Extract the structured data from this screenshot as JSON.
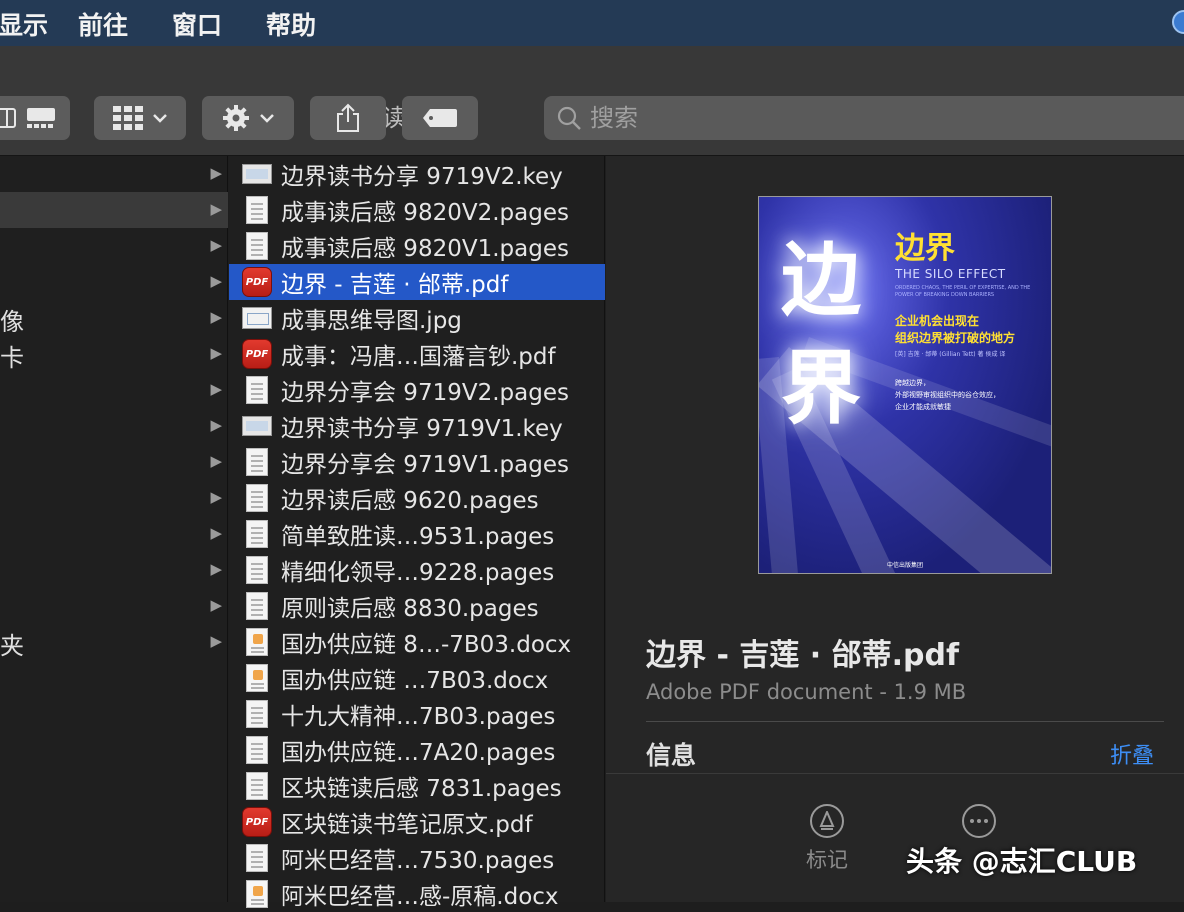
{
  "menubar": {
    "items": [
      "显示",
      "前往",
      "窗口",
      "帮助"
    ]
  },
  "window": {
    "title": "读后感"
  },
  "toolbar": {
    "search_placeholder": "搜索"
  },
  "sidebar_column": {
    "rows": [
      {
        "label": ""
      },
      {
        "label": ""
      },
      {
        "label": ""
      },
      {
        "label": ""
      },
      {
        "label": "像"
      },
      {
        "label": "卡"
      },
      {
        "label": ""
      },
      {
        "label": ""
      },
      {
        "label": ""
      },
      {
        "label": ""
      },
      {
        "label": ""
      },
      {
        "label": ""
      },
      {
        "label": ""
      },
      {
        "label": "夹"
      }
    ]
  },
  "files": [
    {
      "name": "边界读书分享 9719V2.key",
      "icon": "keynote-icon"
    },
    {
      "name": "成事读后感 9820V2.pages",
      "icon": "pages-icon"
    },
    {
      "name": "成事读后感 9820V1.pages",
      "icon": "pages-icon"
    },
    {
      "name": "边界 - 吉莲 · 邰蒂.pdf",
      "icon": "pdf-icon",
      "selected": true
    },
    {
      "name": "成事思维导图.jpg",
      "icon": "image-icon"
    },
    {
      "name": "成事：冯唐…国藩言钞.pdf",
      "icon": "pdf-icon"
    },
    {
      "name": "边界分享会 9719V2.pages",
      "icon": "pages-icon"
    },
    {
      "name": "边界读书分享 9719V1.key",
      "icon": "keynote-icon"
    },
    {
      "name": "边界分享会 9719V1.pages",
      "icon": "pages-icon"
    },
    {
      "name": "边界读后感 9620.pages",
      "icon": "pages-icon"
    },
    {
      "name": "简单致胜读…9531.pages",
      "icon": "pages-icon"
    },
    {
      "name": "精细化领导…9228.pages",
      "icon": "pages-icon"
    },
    {
      "name": "原则读后感 8830.pages",
      "icon": "pages-icon"
    },
    {
      "name": "国办供应链 8…-7B03.docx",
      "icon": "docx-icon"
    },
    {
      "name": "国办供应链 …7B03.docx",
      "icon": "docx-icon"
    },
    {
      "name": "十九大精神…7B03.pages",
      "icon": "pages-icon"
    },
    {
      "name": "国办供应链…7A20.pages",
      "icon": "pages-icon"
    },
    {
      "name": "区块链读后感 7831.pages",
      "icon": "pages-icon"
    },
    {
      "name": "区块链读书笔记原文.pdf",
      "icon": "pdf-icon"
    },
    {
      "name": "阿米巴经营…7530.pages",
      "icon": "pages-icon"
    },
    {
      "name": "阿米巴经营…感-原稿.docx",
      "icon": "docx-icon"
    }
  ],
  "icon_badges": {
    "pdf": "PDF"
  },
  "preview": {
    "cover": {
      "big_title": "边界",
      "title": "边界",
      "english_title": "THE SILO EFFECT",
      "english_subtitle": "ORDERED CHAOS, THE PERIL OF EXPERTISE, AND THE POWER OF BREAKING DOWN BARRIERS",
      "subtitle_line1": "企业机会出现在",
      "subtitle_line2": "组织边界被打破的地方",
      "author": "[英] 吉莲 · 邰蒂 (Gillian Tett) 著 侯成 译",
      "blurb_line1": "跨越边界，",
      "blurb_line2": "外部视野审视组织中的谷仓效应，",
      "blurb_line3": "企业才能成就敏捷",
      "publisher": "中信出版集团"
    },
    "filename": "边界 - 吉莲 · 邰蒂.pdf",
    "kind": "Adobe PDF document - 1.9 MB",
    "info_label": "信息",
    "collapse_label": "折叠",
    "actions": [
      {
        "label": "标记",
        "icon": "markup-icon"
      },
      {
        "label": "",
        "icon": "more-icon"
      }
    ]
  },
  "watermark": "头条 @志汇CLUB",
  "colors": {
    "selection": "#2458c8",
    "accent_link": "#3d8ef5",
    "menubar": "#243a55"
  }
}
